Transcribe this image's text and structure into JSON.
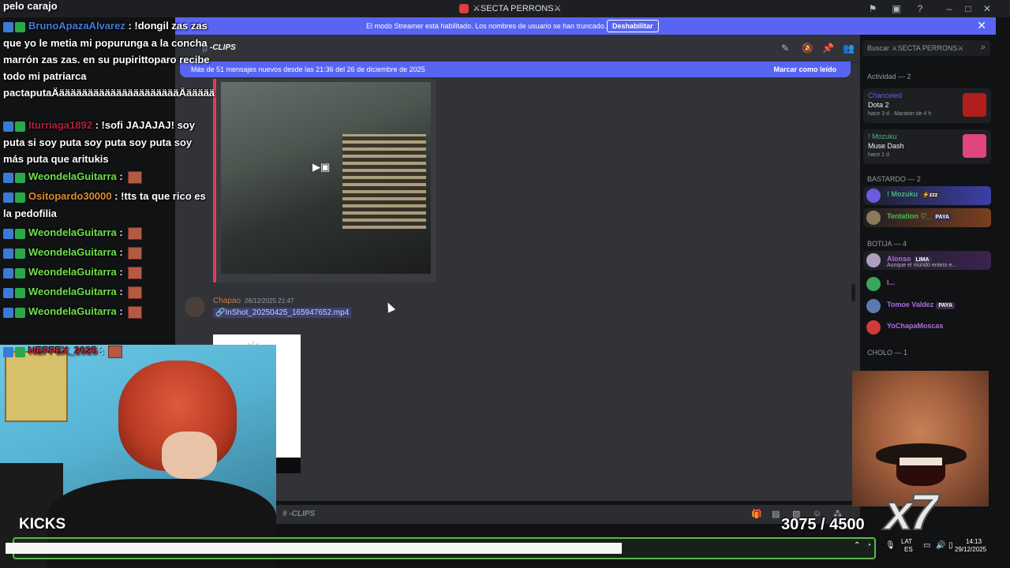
{
  "window": {
    "server_name": "⚔SECTA PERRONS⚔"
  },
  "banner": {
    "message": "El modo Streamer está habilitado. Los nombres de usuario se han truncado.",
    "disable_label": "Deshabilitar"
  },
  "channel": {
    "name": "-CLIPS",
    "search_placeholder": "Buscar ⚔SECTA PERRONS⚔"
  },
  "new_messages": {
    "text": "Más de 51 mensajes nuevos desde las 21:36 del 26 de diciembre de 2025",
    "mark_read": "Marcar como leído"
  },
  "message": {
    "author": "Chapao",
    "timestamp": "26/12/2025 21:47",
    "attachment": "InShot_20250425_165947652.mp4"
  },
  "composer": {
    "channel_name": "-CLIPS"
  },
  "members": {
    "activity_title": "Actividad — 2",
    "activities": [
      {
        "user": "Chanceled",
        "game": "Dota 2",
        "meta": "hace 3 d  ·  Maratón de 4 h",
        "user_color": "#5865f2",
        "icon_color": "#b01e1e"
      },
      {
        "user": "! Mozuku",
        "game": "Muse Dash",
        "meta": "hace 1 d",
        "user_color": "#43b581",
        "icon_color": "#e0457b"
      }
    ],
    "groups": [
      {
        "title": "BASTARDO — 2",
        "members": [
          {
            "name": "! Mozuku",
            "badge": "⚡zzz",
            "color": "#43b581",
            "sub": ""
          },
          {
            "name": "Tentation ♡_",
            "badge": "PAYA",
            "color": "#3fc15a",
            "sub": ""
          }
        ]
      },
      {
        "title": "BOTIJA — 4",
        "members": [
          {
            "name": "Alonso",
            "badge": "LIMA",
            "color": "#b06ee0",
            "sub": "Aunque el mundo entero e..."
          },
          {
            "name": "l...",
            "badge": "",
            "color": "#b06ee0",
            "sub": ""
          },
          {
            "name": "Tomoe Valdez",
            "badge": "PAYA",
            "color": "#b06ee0",
            "sub": ""
          },
          {
            "name": "YoChapaMoscas",
            "badge": "",
            "color": "#b06ee0",
            "sub": ""
          }
        ]
      },
      {
        "title": "CHOLO — 1",
        "members": []
      }
    ]
  },
  "stream_chat": {
    "top_text": "pelo carajo",
    "messages": [
      {
        "user": "BrunoApazaAlvarez",
        "user_color": "#4a7bd6",
        "text": ": !dongil zas zas que yo le metia mi popurunga a la concha marrón zas zas. en su pupirittoparo recibe todo mi patriarca pactaputaÄäääääääääääääääääääääÄäääää"
      },
      {
        "user": "Iturriaga1892",
        "user_color": "#b0213a",
        "text": ": !sofi JAJAJAJ! soy puta si soy puta soy puta soy puta soy más puta que aritukis"
      },
      {
        "user": "WeondelaGuitarra",
        "user_color": "#6fe04a",
        "text": ":"
      },
      {
        "user": "Ositopardo30000",
        "user_color": "#e08a2a",
        "text": ": !tts ta que rico es la pedofilia"
      },
      {
        "user": "WeondelaGuitarra",
        "user_color": "#6fe04a",
        "text": ":"
      },
      {
        "user": "WeondelaGuitarra",
        "user_color": "#6fe04a",
        "text": ":"
      },
      {
        "user": "WeondelaGuitarra",
        "user_color": "#6fe04a",
        "text": ":"
      },
      {
        "user": "WeondelaGuitarra",
        "user_color": "#6fe04a",
        "text": ":"
      },
      {
        "user": "WeondelaGuitarra",
        "user_color": "#6fe04a",
        "text": ":"
      },
      {
        "user": "NEFFEX_2025",
        "user_color": "#c0243a",
        "text": ":"
      }
    ]
  },
  "stream": {
    "kicks_label": "KICKS",
    "goal_text": "3075  / 4500",
    "goal_current": 3075,
    "goal_target": 4500,
    "meme_multiplier": "x7"
  },
  "tray": {
    "lang_line1": "LAT",
    "lang_line2": "ES",
    "time": "14:13",
    "date": "29/12/2025"
  }
}
